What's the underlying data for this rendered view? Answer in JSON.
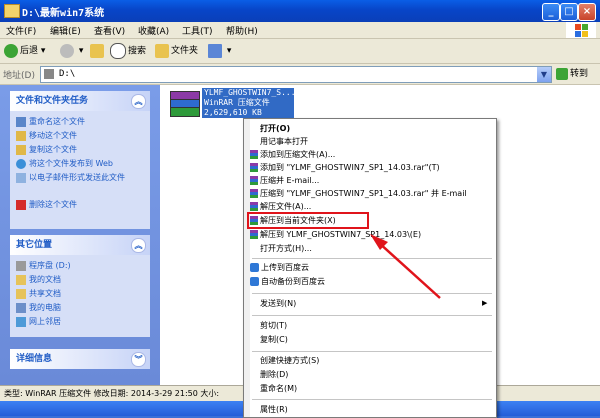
{
  "window": {
    "title": "D:\\最新win7系统"
  },
  "menubar": [
    "文件(F)",
    "编辑(E)",
    "查看(V)",
    "收藏(A)",
    "工具(T)",
    "帮助(H)"
  ],
  "toolbar": {
    "back": "后退",
    "search": "搜索",
    "folders": "文件夹"
  },
  "address": {
    "label": "地址(D)",
    "value": "D:\\",
    "go": "转到"
  },
  "tasks_panel": {
    "title": "文件和文件夹任务",
    "items": [
      "重命名这个文件",
      "移动这个文件",
      "复制这个文件",
      "将这个文件发布到 Web",
      "以电子邮件形式发送此文件",
      "删除这个文件"
    ]
  },
  "other_places": {
    "title": "其它位置",
    "items": [
      "程序盘 (D:)",
      "我的文档",
      "共享文档",
      "我的电脑",
      "网上邻居"
    ]
  },
  "details_panel": {
    "title": "详细信息"
  },
  "file": {
    "line1": "YLMF_GHOSTWIN7_S...",
    "line2": "WinRAR 压缩文件",
    "line3": "2,629,610 KB"
  },
  "context_menu": {
    "items": [
      "打开(O)",
      "用记事本打开",
      "添加到压缩文件(A)...",
      "添加到 \"YLMF_GHOSTWIN7_SP1_14.03.rar\"(T)",
      "压缩并 E-mail...",
      "压缩到 \"YLMF_GHOSTWIN7_SP1_14.03.rar\" 并 E-mail",
      "解压文件(A)...",
      "解压到当前文件夹(X)",
      "解压到 YLMF_GHOSTWIN7_SP1_14.03\\(E)",
      "打开方式(H)...",
      "上传到百度云",
      "自动备份到百度云",
      "发送到(N)",
      "剪切(T)",
      "复制(C)",
      "创建快捷方式(S)",
      "删除(D)",
      "重命名(M)",
      "属性(R)"
    ]
  },
  "statusbar": {
    "text": "类型: WinRAR 压缩文件 修改日期: 2014-3-29 21:50 大小:"
  },
  "colors": {
    "highlight": "#e0141b",
    "selection": "#316ac5",
    "link": "#215dc6"
  }
}
